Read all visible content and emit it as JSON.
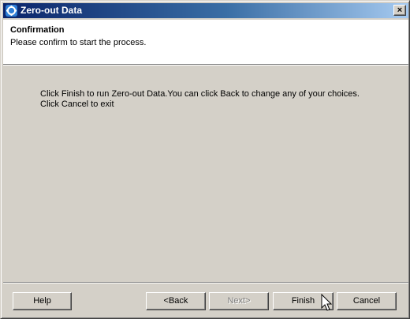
{
  "window": {
    "title": "Zero-out Data",
    "close_glyph": "×"
  },
  "header": {
    "title": "Confirmation",
    "subtitle": "Please confirm to start the process."
  },
  "body": {
    "line1": "Click Finish to run Zero-out Data.You can click Back to change any of your choices.",
    "line2": "Click Cancel to exit"
  },
  "buttons": {
    "help": "Help",
    "back": "<Back",
    "next": "Next>",
    "finish": "Finish",
    "cancel": "Cancel"
  },
  "icons": {
    "app": "app-logo-icon",
    "close": "close-icon",
    "cursor": "mouse-pointer-icon"
  },
  "colors": {
    "titlebar_start": "#0a246a",
    "titlebar_end": "#a6caf0",
    "window_bg": "#d4d0c8"
  }
}
